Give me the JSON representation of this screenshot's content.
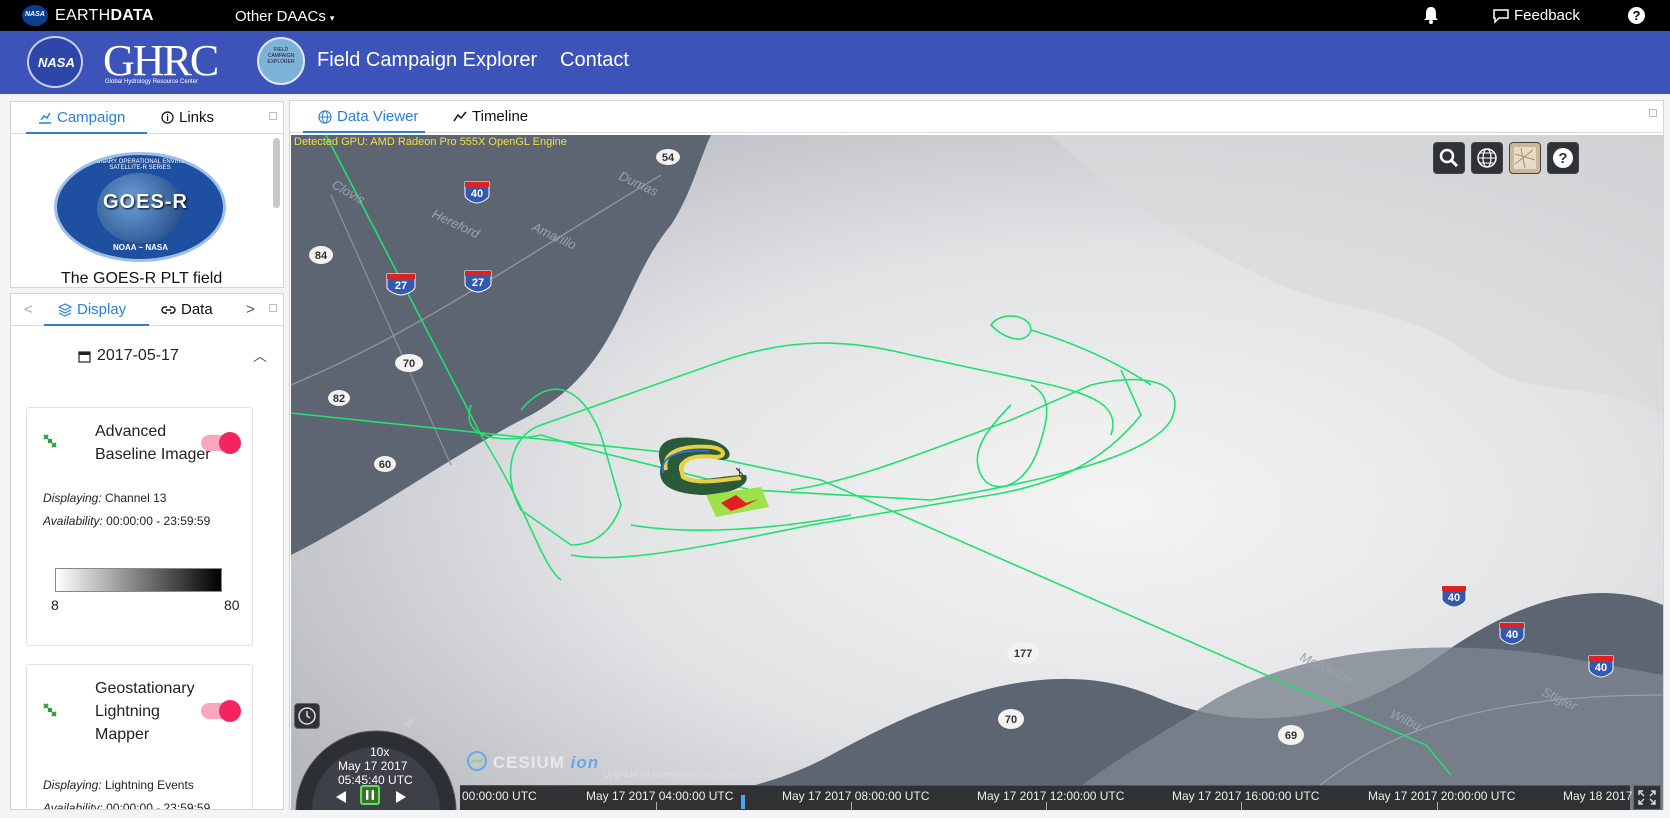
{
  "topbar": {
    "nasa_mini": "NASA",
    "brand_plain": "EARTH",
    "brand_bold": "DATA",
    "other_daacs": "Other DAACs",
    "feedback": "Feedback",
    "help": "?"
  },
  "header": {
    "nasa_logo": "NASA",
    "ghrc_logo": "GHRC",
    "ghrc_sub": "Global Hydrology Resource Center",
    "fce_logo": "FIELD CAMPAIGN EXPLORER",
    "nav": [
      "Field Campaign Explorer",
      "Contact"
    ]
  },
  "campaign_panel": {
    "tabs": [
      "Campaign",
      "Links"
    ],
    "goes_logo": {
      "title": "GOES-R",
      "ring": "GEOSTATIONARY OPERATIONAL ENVIRONMENTAL SATELLITE-R SERIES",
      "bottom": "NOAA ~ NASA"
    },
    "text": "The GOES-R PLT field"
  },
  "display_panel": {
    "tabs": [
      "Display",
      "Data"
    ],
    "prev": "<",
    "next": ">",
    "date": "2017-05-17",
    "layers": [
      {
        "name": "Advanced Baseline Imager",
        "displaying_label": "Displaying:",
        "displaying": "Channel 13",
        "availability_label": "Availability:",
        "availability": "00:00:00 - 23:59:59",
        "cb_min": "8",
        "cb_max": "80"
      },
      {
        "name": "Geostationary Lightning Mapper",
        "displaying_label": "Displaying:",
        "displaying": "Lightning Events",
        "availability_label": "Availability:",
        "availability": "00:00:00 - 23:59:59"
      }
    ]
  },
  "viewer": {
    "tabs": [
      "Data Viewer",
      "Timeline"
    ],
    "gpu_text": "Detected GPU: AMD Radeon Pro 555X OpenGL Engine",
    "map_labels": [
      "Dumas",
      "Amarillo",
      "Clovis",
      "Hereford",
      "Stigler",
      "McAlester",
      "Wilbu"
    ],
    "road_shields": [
      "40",
      "27",
      "27",
      "54",
      "84",
      "70",
      "82",
      "60",
      "177",
      "70",
      "69",
      "40",
      "40",
      "40"
    ],
    "animation": {
      "speed": "10x",
      "date": "May 17 2017",
      "time": "05:45:40 UTC"
    },
    "cesium": "CESIUM",
    "cesium_ion": "ion",
    "cesium_sub": "Upgrade for commercial use.  Data attribution",
    "timeline_labels": [
      "00:00:00 UTC",
      "May 17 2017 04:00:00 UTC",
      "May 17 2017 08:00:00 UTC",
      "May 17 2017 12:00:00 UTC",
      "May 17 2017 16:00:00 UTC",
      "May 17 2017 20:00:00 UTC",
      "May 18 2017"
    ]
  },
  "colors": {
    "earthdata_bar": "#000000",
    "header_blue": "#3c54b9",
    "tab_active": "#2a7fd6",
    "toggle_on": "#f4245e",
    "flight_track": "#22e070"
  }
}
